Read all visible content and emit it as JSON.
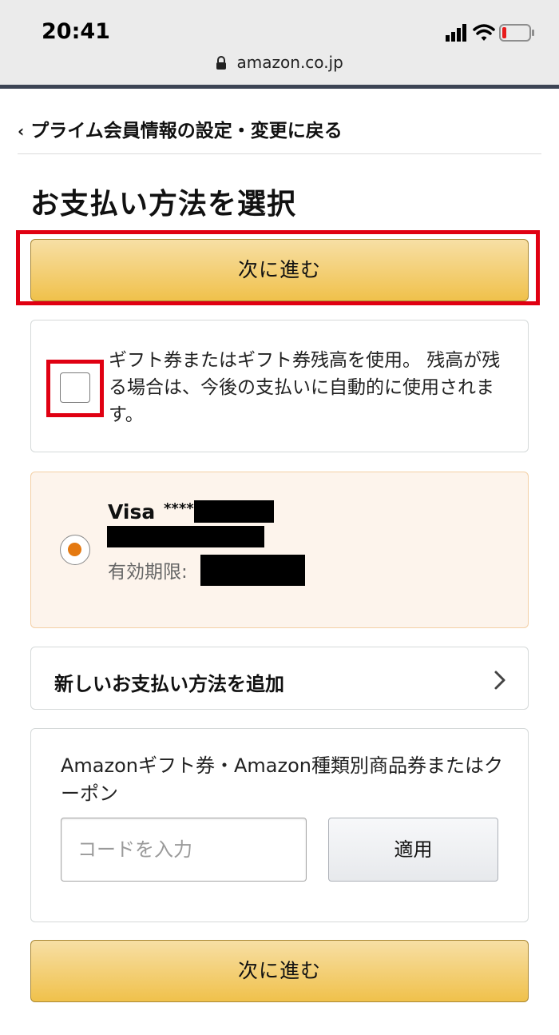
{
  "status_bar": {
    "time": "20:41",
    "url": "amazon.co.jp",
    "icons": [
      "signal-icon",
      "wifi-icon",
      "battery-low-icon"
    ]
  },
  "nav": {
    "back_label": "プライム会員情報の設定・変更に戻る"
  },
  "page": {
    "title": "お支払い方法を選択",
    "next_button_top": "次に進む",
    "next_button_bottom": "次に進む"
  },
  "gift": {
    "checkbox_label": "ギフト券またはギフト券残高を使用。 残高が残る場合は、今後の支払いに自動的に使用されます。",
    "checked": false
  },
  "payment_method": {
    "brand": "Visa",
    "masked_number": "****",
    "expiry_label": "有効期限:",
    "selected": true
  },
  "add_method": {
    "label": "新しいお支払い方法を追加"
  },
  "coupon": {
    "label": "Amazonギフト券・Amazon種類別商品券またはクーポン",
    "input_placeholder": "コードを入力",
    "apply_label": "適用"
  },
  "colors": {
    "primary_button": "#f0c14b",
    "highlight_red": "#e00012",
    "selected_card_bg": "#fdf4ec",
    "radio_accent": "#e47911"
  }
}
